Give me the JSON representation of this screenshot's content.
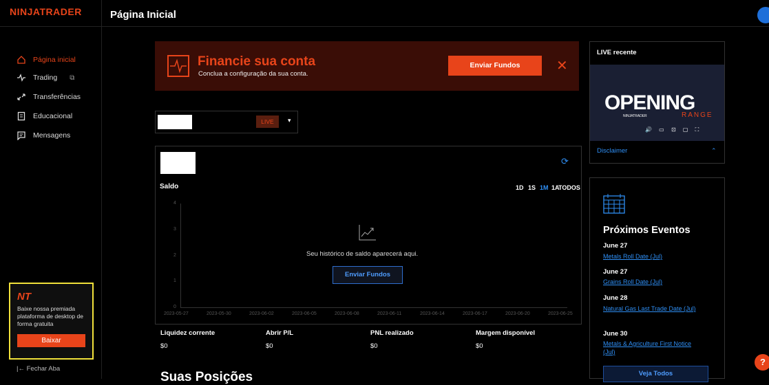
{
  "brand": "NINJATRADER",
  "page_title": "Página Inicial",
  "sidebar": {
    "items": [
      {
        "label": "Página inicial",
        "icon": "home-icon"
      },
      {
        "label": "Trading",
        "icon": "pulse-icon"
      },
      {
        "label": "Transferências",
        "icon": "transfer-icon"
      },
      {
        "label": "Educacional",
        "icon": "book-icon"
      },
      {
        "label": "Mensagens",
        "icon": "message-icon"
      }
    ],
    "promo": {
      "logo": "NT",
      "text": "Baixe nossa premiada plataforma de desktop de forma gratuita",
      "button": "Baixar"
    },
    "close_tab": "Fechar Aba"
  },
  "banner": {
    "title": "Financie sua conta",
    "subtitle": "Conclua a configuração da sua conta.",
    "button": "Enviar Fundos",
    "close": "✕"
  },
  "account": {
    "badge": "LIVE",
    "caret": "▾"
  },
  "chart": {
    "label": "Saldo",
    "ranges": [
      "1D",
      "1S",
      "1M",
      "1A",
      "TODOS"
    ],
    "empty_text": "Seu histórico de saldo aparecerá aqui.",
    "empty_button": "Enviar Fundos"
  },
  "chart_data": {
    "type": "line",
    "x": [
      "2023-05-27",
      "2023-05-30",
      "2023-06-02",
      "2023-06-05",
      "2023-06-08",
      "2023-06-11",
      "2023-06-14",
      "2023-06-17",
      "2023-06-20",
      "2023-06-25"
    ],
    "yticks": [
      "0",
      "1",
      "2",
      "3",
      "4"
    ],
    "ylim": [
      0,
      4
    ],
    "series": []
  },
  "stats": [
    {
      "label": "Liquidez corrente",
      "value": "$0"
    },
    {
      "label": "Abrir P/L",
      "value": "$0"
    },
    {
      "label": "PNL realizado",
      "value": "$0"
    },
    {
      "label": "Margem disponível",
      "value": "$0"
    }
  ],
  "positions_title": "Suas Posições",
  "live": {
    "title": "LIVE recente",
    "video_title": "OPENING",
    "video_sub": "RANGE",
    "video_brand": "NINJATRADER",
    "disclaimer": "Disclaimer"
  },
  "events": {
    "title": "Próximos Eventos",
    "items": [
      {
        "date": "June 27",
        "name": "Metals Roll Date (Jul)"
      },
      {
        "date": "June 27",
        "name": "Grains Roll Date (Jul)"
      },
      {
        "date": "June 28",
        "name": "Natural Gas Last Trade Date (Jul)"
      },
      {
        "date": "June 30",
        "name": "Metals & Agriculture First Notice (Jul)"
      }
    ],
    "see_all": "Veja Todos"
  },
  "colors": {
    "accent": "#e8441a",
    "link": "#2f8ff5",
    "background": "#000000",
    "highlight": "#f2e23b"
  }
}
